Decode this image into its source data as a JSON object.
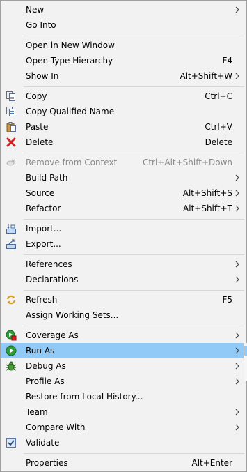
{
  "menu": {
    "items": {
      "new": {
        "label": "New",
        "shortcut": ""
      },
      "go_into": {
        "label": "Go Into",
        "shortcut": ""
      },
      "open_new_window": {
        "label": "Open in New Window",
        "shortcut": ""
      },
      "open_type_hierarchy": {
        "label": "Open Type Hierarchy",
        "shortcut": "F4"
      },
      "show_in": {
        "label": "Show In",
        "shortcut": "Alt+Shift+W"
      },
      "copy": {
        "label": "Copy",
        "shortcut": "Ctrl+C"
      },
      "copy_qualified_name": {
        "label": "Copy Qualified Name",
        "shortcut": ""
      },
      "paste": {
        "label": "Paste",
        "shortcut": "Ctrl+V"
      },
      "delete": {
        "label": "Delete",
        "shortcut": "Delete"
      },
      "remove_from_context": {
        "label": "Remove from Context",
        "shortcut": "Ctrl+Alt+Shift+Down"
      },
      "build_path": {
        "label": "Build Path",
        "shortcut": ""
      },
      "source": {
        "label": "Source",
        "shortcut": "Alt+Shift+S"
      },
      "refactor": {
        "label": "Refactor",
        "shortcut": "Alt+Shift+T"
      },
      "import": {
        "label": "Import...",
        "shortcut": ""
      },
      "export": {
        "label": "Export...",
        "shortcut": ""
      },
      "references": {
        "label": "References",
        "shortcut": ""
      },
      "declarations": {
        "label": "Declarations",
        "shortcut": ""
      },
      "refresh": {
        "label": "Refresh",
        "shortcut": "F5"
      },
      "assign_working_sets": {
        "label": "Assign Working Sets...",
        "shortcut": ""
      },
      "coverage_as": {
        "label": "Coverage As",
        "shortcut": ""
      },
      "run_as": {
        "label": "Run As",
        "shortcut": ""
      },
      "debug_as": {
        "label": "Debug As",
        "shortcut": ""
      },
      "profile_as": {
        "label": "Profile As",
        "shortcut": ""
      },
      "restore_local_history": {
        "label": "Restore from Local History...",
        "shortcut": ""
      },
      "team": {
        "label": "Team",
        "shortcut": ""
      },
      "compare_with": {
        "label": "Compare With",
        "shortcut": ""
      },
      "validate": {
        "label": "Validate",
        "shortcut": ""
      },
      "properties": {
        "label": "Properties",
        "shortcut": "Alt+Enter"
      }
    },
    "highlighted_item": "Run As",
    "disabled_items": [
      "Remove from Context"
    ],
    "checked_items": [
      "Validate"
    ]
  },
  "colors": {
    "menu_background": "#f2f2f2",
    "highlight": "#91c9f7",
    "separator": "#d7d7d7",
    "disabled_text": "#8a8a8a"
  },
  "icons": {
    "copy": "copy-icon",
    "copy_qualified_name": "copy-qualified-name-icon",
    "paste": "paste-icon",
    "delete": "delete-icon",
    "remove_from_context": "remove-from-context-icon",
    "import": "import-icon",
    "export": "export-icon",
    "refresh": "refresh-icon",
    "coverage_as": "coverage-icon",
    "run_as": "run-icon",
    "debug_as": "debug-icon",
    "validate": "checkmark-icon",
    "submenu": "chevron-right-icon"
  }
}
